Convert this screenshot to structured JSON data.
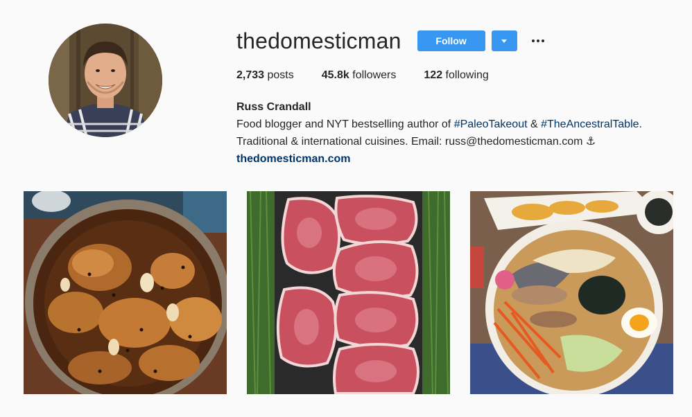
{
  "profile": {
    "username": "thedomesticman",
    "follow_label": "Follow",
    "stats": {
      "posts_count": "2,733",
      "posts_label": "posts",
      "followers_count": "45.8k",
      "followers_label": "followers",
      "following_count": "122",
      "following_label": "following"
    },
    "bio": {
      "full_name": "Russ Crandall",
      "line1_text": "Food blogger and NYT bestselling author of ",
      "hashtag1": "#PaleoTakeout",
      "line1_mid": " & ",
      "hashtag2": "#TheAncestralTable",
      "line1_end": ".",
      "line2_text": "Traditional & international cuisines. Email: russ@thedomesticman.com ⚓",
      "website": "thedomesticman.com"
    }
  },
  "posts": [
    {
      "subject": "braised chicken with garlic and peppercorns"
    },
    {
      "subject": "raw ribeye steaks on a grill"
    },
    {
      "subject": "ramen bowl with egg and tempura"
    }
  ],
  "colors": {
    "accent": "#3897f0",
    "link": "#003569",
    "background": "#fafafa",
    "text": "#262626"
  },
  "icons": {
    "dropdown": "chevron-down-icon",
    "more": "more-options-icon"
  }
}
